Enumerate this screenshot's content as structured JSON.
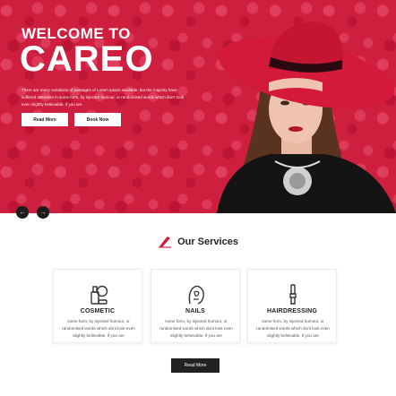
{
  "hero": {
    "welcome": "WELCOME TO",
    "title": "CAREO",
    "description": "There are many variations of passages of Lorem Ipsum available, but the majority have suffered alteration in some form, by injected humour, or randomised words which don't look even slightly believable. If you are",
    "btn_read_more": "Read More",
    "btn_book_now": "Book Now",
    "prev_arrow": "←",
    "next_arrow": "→"
  },
  "services": {
    "heading": "Our Services",
    "cards": [
      {
        "title": "COSMETIC",
        "icon": "cosmetic-icon",
        "description": "some form, by injected humour, or randomised words which dont look even slightly believable. If you are"
      },
      {
        "title": "NAILS",
        "icon": "nails-icon",
        "description": "some form, by injected humour, or randomised words which dont look even slightly believable. If you are"
      },
      {
        "title": "HAIRDRESSING",
        "icon": "hairdressing-icon",
        "description": "some form, by injected humour, or randomised words which dont look even slightly believable. If you are"
      }
    ],
    "more_button": "Read More"
  },
  "colors": {
    "brand_red": "#cf1f3f",
    "dark": "#222222"
  }
}
